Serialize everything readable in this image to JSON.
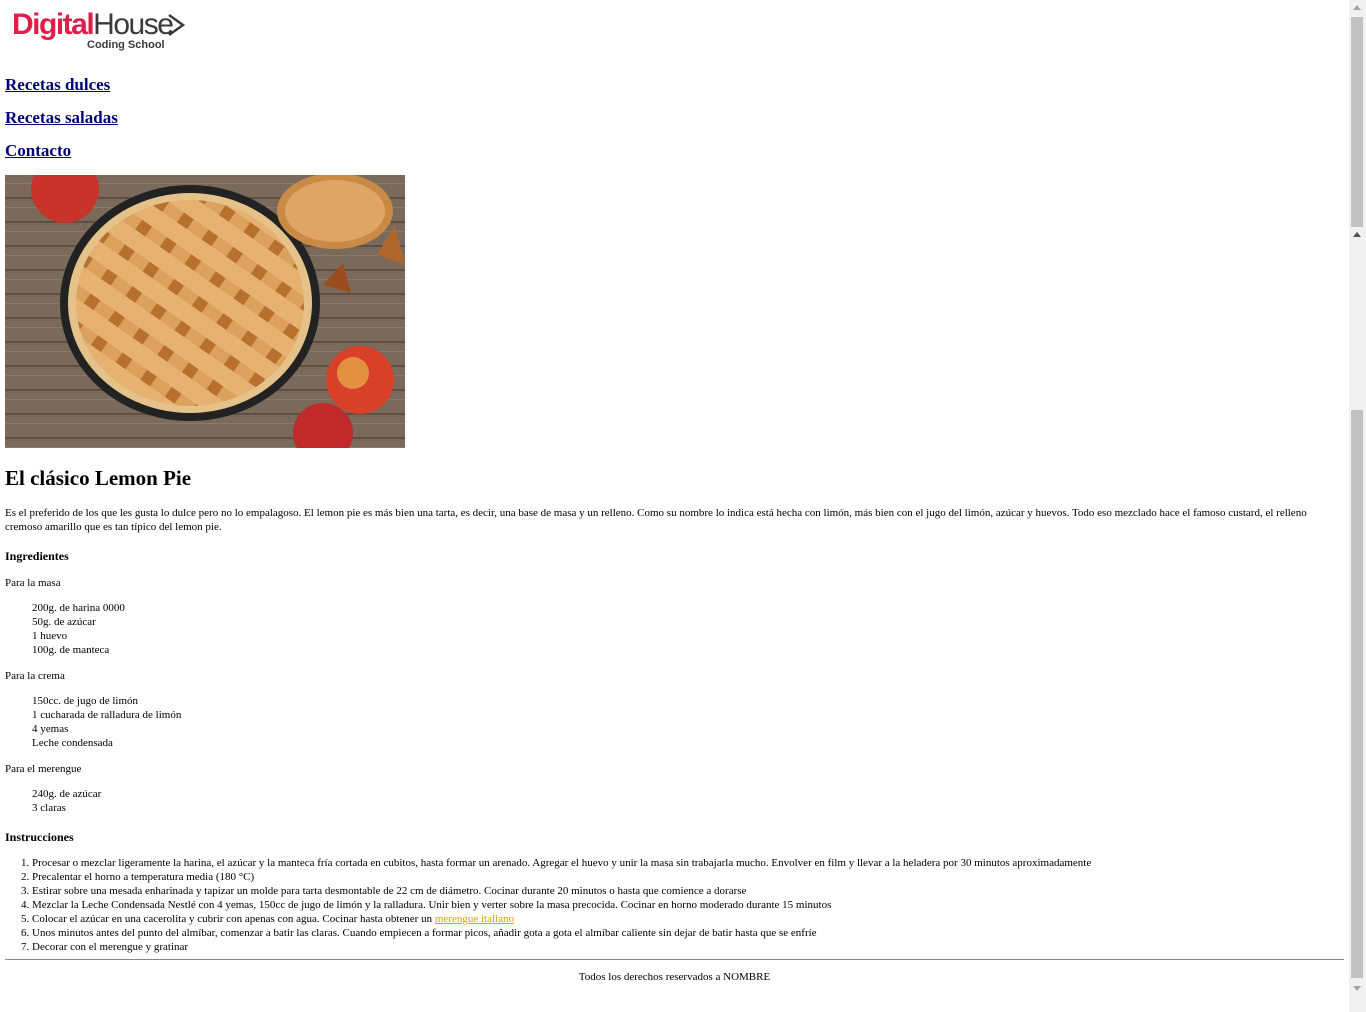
{
  "logo": {
    "part1": "Digital",
    "part2": "House",
    "sub": "Coding School"
  },
  "nav": [
    {
      "label": "Recetas dulces"
    },
    {
      "label": "Recetas saladas"
    },
    {
      "label": "Contacto"
    }
  ],
  "recipe": {
    "title": "El clásico Lemon Pie",
    "intro": "Es el preferido de los que les gusta lo dulce pero no lo empalagoso. El lemon pie es más bien una tarta, es decir, una base de masa y un relleno. Como su nombre lo indica está hecha con limón, más bien con el jugo del limón, azúcar y huevos. Todo eso mezclado hace el famoso custard, el relleno cremoso amarillo que es tan típico del lemon pie.",
    "ingredients_heading": "Ingredientes",
    "groups": [
      {
        "title": "Para la masa",
        "items": [
          "200g. de harina 0000",
          "50g. de azúcar",
          "1 huevo",
          "100g. de manteca"
        ]
      },
      {
        "title": "Para la crema",
        "items": [
          "150cc. de jugo de limón",
          "1 cucharada de ralladura de limón",
          "4 yemas",
          "Leche condensada"
        ]
      },
      {
        "title": "Para el merengue",
        "items": [
          "240g. de azúcar",
          "3 claras"
        ]
      }
    ],
    "instructions_heading": "Instrucciones",
    "steps": [
      "Procesar o mezclar ligeramente la harina, el azúcar y la manteca fría cortada en cubitos, hasta formar un arenado. Agregar el huevo y unir la masa sin trabajarla mucho. Envolver en film y llevar a la heladera por 30 minutos aproximadamente",
      "Precalentar el horno a temperatura media (180 °C)",
      "Estirar sobre una mesada enharinada y tapizar un molde para tarta desmontable de 22 cm de diámetro. Cocinar durante 20 minutos o hasta que comience a dorarse",
      "Mezclar la Leche Condensada Nestlé con 4 yemas, 150cc de jugo de limón y la ralladura. Unir bien y verter sobre la masa precocida. Cocinar en horno moderado durante 15 minutos",
      "Colocar el azúcar en una cacerolita y cubrir con apenas con agua. Cocinar hasta obtener un",
      "Unos minutos antes del punto del almíbar, comenzar a batir las claras. Cuando empiecen a formar picos, añadir gota a gota el almíbar caliente sin dejar de batir hasta que se enfríe",
      "Decorar con el merengue y gratinar"
    ],
    "step5_link": "merengue italiano"
  },
  "footer": {
    "text": "Todos los derechos reservados a NOMBRE"
  },
  "colors": {
    "link": "#00007d",
    "brand_red": "#e01e4a",
    "link_yellow": "#d7a300"
  }
}
